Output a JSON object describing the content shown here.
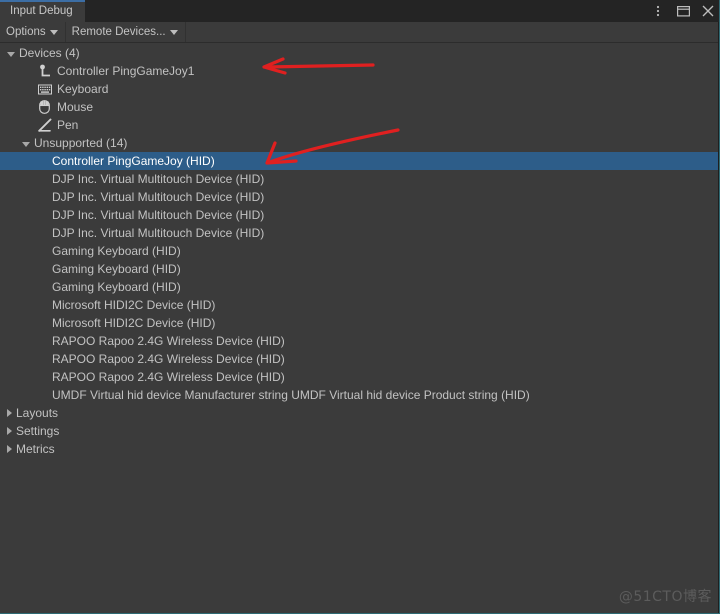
{
  "window": {
    "tab_label": "Input Debug",
    "controls": [
      {
        "name": "kebab-menu-icon",
        "label": "⋮"
      },
      {
        "name": "maximize-icon",
        "label": "❐"
      },
      {
        "name": "close-icon",
        "label": "✕"
      }
    ],
    "accent_color": "#3c6ea5",
    "background_color": "#3b3b3b",
    "tabbar_color": "#242424",
    "selection_color": "#2d5d89"
  },
  "toolbar": {
    "options_label": "Options",
    "remote_devices_label": "Remote Devices..."
  },
  "tree": {
    "devices_group": {
      "label": "Devices (4)",
      "expanded": true,
      "items": [
        {
          "label": "Controller PingGameJoy1",
          "icon": "joystick-icon"
        },
        {
          "label": "Keyboard",
          "icon": "keyboard-icon"
        },
        {
          "label": "Mouse",
          "icon": "mouse-icon"
        },
        {
          "label": "Pen",
          "icon": "pen-icon"
        }
      ]
    },
    "unsupported_group": {
      "label": "Unsupported (14)",
      "expanded": true,
      "items": [
        {
          "label": "Controller PingGameJoy (HID)",
          "selected": true
        },
        {
          "label": "DJP Inc. Virtual Multitouch Device (HID)",
          "selected": false
        },
        {
          "label": "DJP Inc. Virtual Multitouch Device (HID)",
          "selected": false
        },
        {
          "label": "DJP Inc. Virtual Multitouch Device (HID)",
          "selected": false
        },
        {
          "label": "DJP Inc. Virtual Multitouch Device (HID)",
          "selected": false
        },
        {
          "label": "Gaming Keyboard (HID)",
          "selected": false
        },
        {
          "label": "Gaming Keyboard (HID)",
          "selected": false
        },
        {
          "label": "Gaming Keyboard (HID)",
          "selected": false
        },
        {
          "label": "Microsoft HIDI2C Device (HID)",
          "selected": false
        },
        {
          "label": "Microsoft HIDI2C Device (HID)",
          "selected": false
        },
        {
          "label": "RAPOO Rapoo 2.4G Wireless Device (HID)",
          "selected": false
        },
        {
          "label": "RAPOO Rapoo 2.4G Wireless Device (HID)",
          "selected": false
        },
        {
          "label": "RAPOO Rapoo 2.4G Wireless Device (HID)",
          "selected": false
        },
        {
          "label": "UMDF Virtual hid device Manufacturer string UMDF Virtual hid device Product string (HID)",
          "selected": false
        }
      ]
    },
    "collapsed_groups": [
      {
        "label": "Layouts"
      },
      {
        "label": "Settings"
      },
      {
        "label": "Metrics"
      }
    ]
  },
  "annotations": {
    "color": "#e02020",
    "arrow_top_target": "Controller PingGameJoy1",
    "arrow_bottom_target": "Controller PingGameJoy (HID)"
  },
  "watermark": {
    "text": "@51CTO博客"
  }
}
